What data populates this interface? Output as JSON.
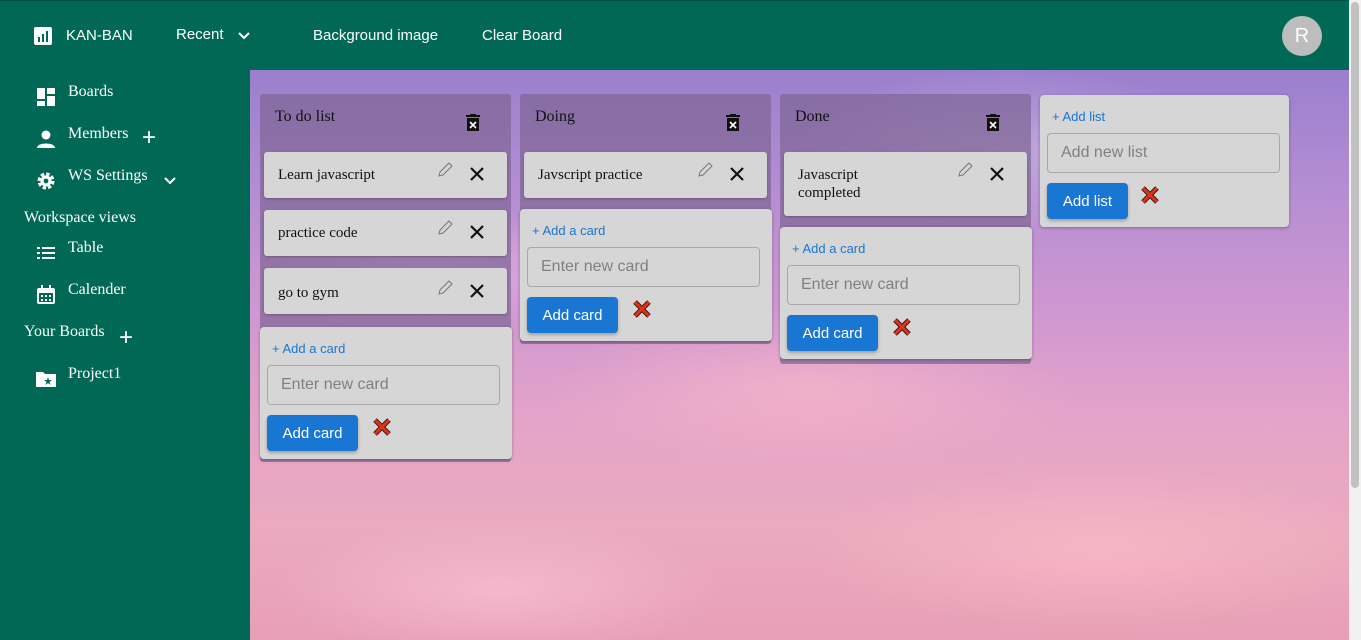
{
  "app": {
    "brand": "KAN-BAN",
    "avatar_initial": "R"
  },
  "nav": {
    "recent": "Recent",
    "background_image": "Background image",
    "clear_board": "Clear Board"
  },
  "sidebar": {
    "boards": "Boards",
    "members": "Members",
    "ws_settings": "WS Settings",
    "workspace_views": "Workspace views",
    "table": "Table",
    "calender": "Calender",
    "your_boards": "Your Boards",
    "project": "Project1"
  },
  "lists": [
    {
      "title": "To do list",
      "cards": [
        "Learn javascript",
        "practice code",
        "go to gym"
      ]
    },
    {
      "title": "Doing",
      "cards": [
        "Javscript practice"
      ]
    },
    {
      "title": "Done",
      "cards": [
        "Javascript completed"
      ]
    }
  ],
  "card_composer": {
    "add_link": "+ Add a card",
    "placeholder": "Enter new card",
    "button": "Add card"
  },
  "list_composer": {
    "add_link": "+ Add list",
    "placeholder": "Add new list",
    "button": "Add list"
  },
  "colors": {
    "primary": "#006854",
    "accent": "#1976d2",
    "danger": "#d32f2f"
  },
  "icons": [
    "dashboard-icon",
    "chevron-down-icon",
    "boards-icon",
    "person-icon",
    "add-icon",
    "gear-icon",
    "table-icon",
    "calendar-icon",
    "folder-star-icon",
    "trash-icon",
    "pencil-icon",
    "close-icon",
    "red-x-icon"
  ]
}
